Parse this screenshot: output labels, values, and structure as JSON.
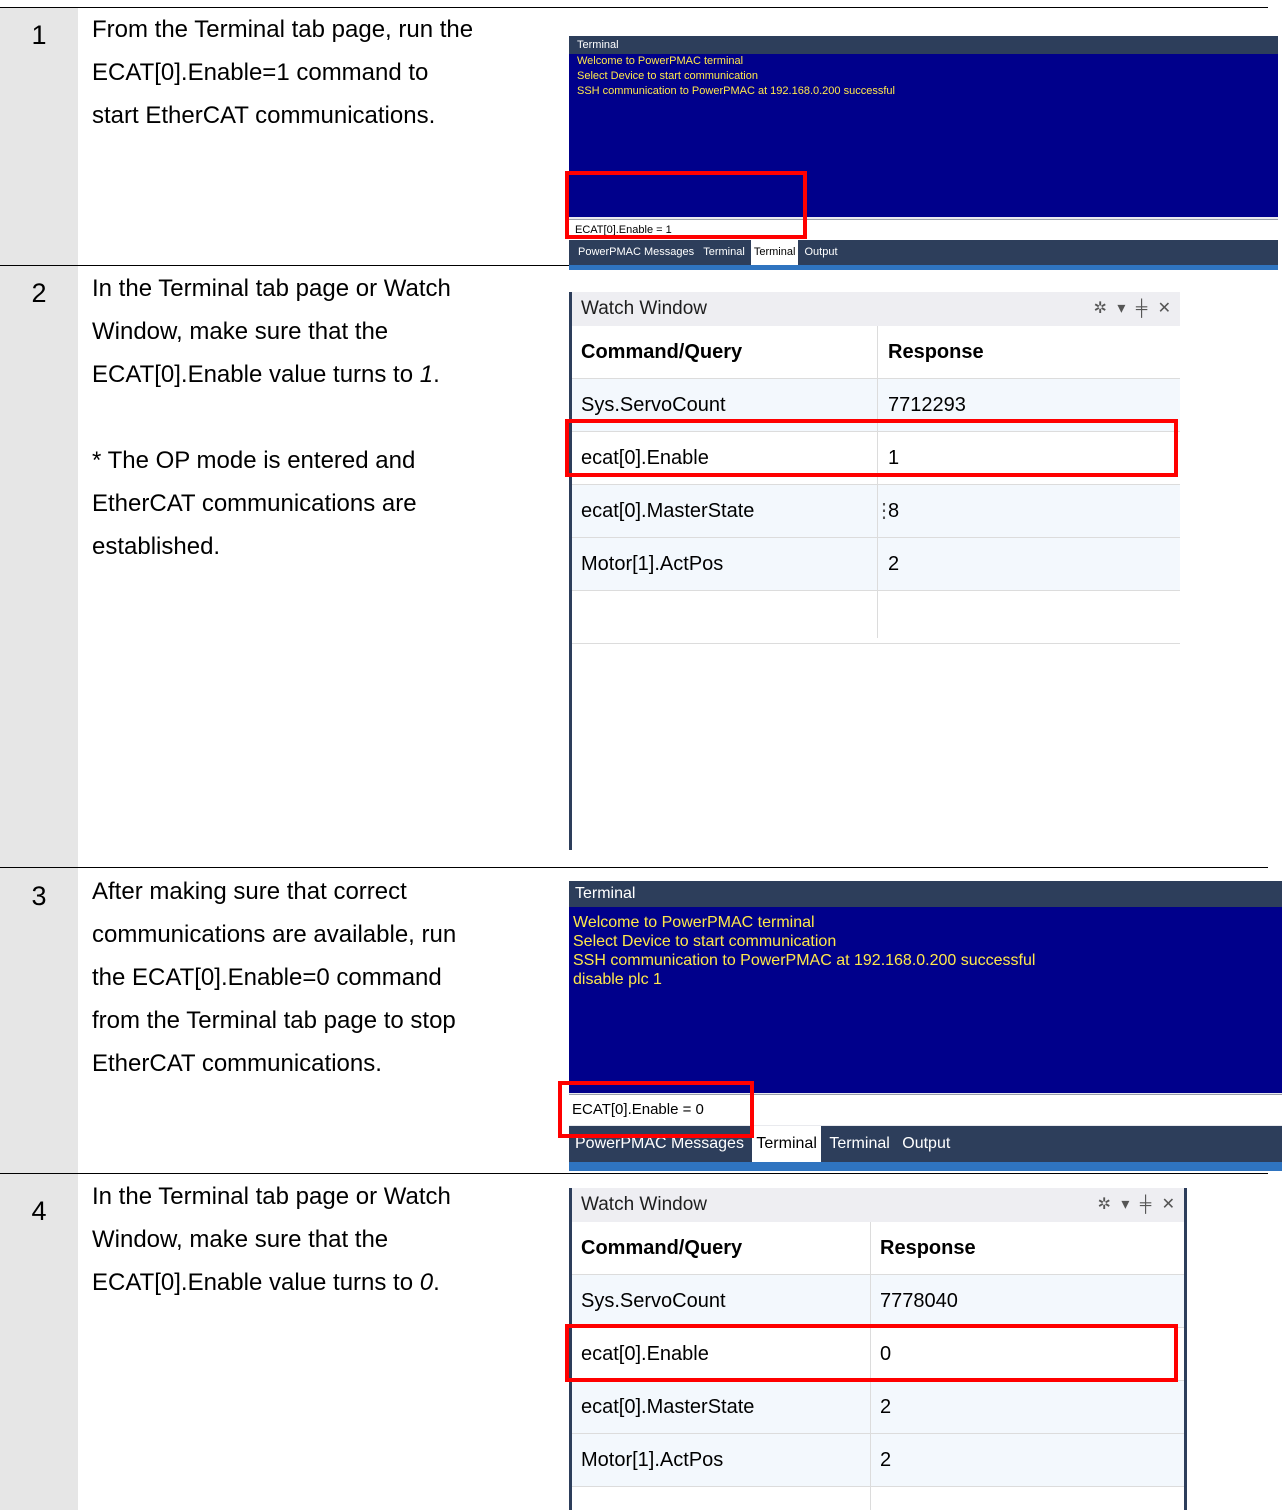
{
  "steps": [
    {
      "num": "1",
      "text": [
        "From the Terminal tab page, run the",
        "ECAT[0].Enable=1 command to",
        "start EtherCAT communications."
      ]
    },
    {
      "num": "2",
      "text": [
        "In the Terminal tab page or Watch",
        "Window, make sure that the"
      ],
      "text_before_em": "ECAT[0].Enable value turns to ",
      "em_value": "1",
      "text_after_em": ".",
      "note": [
        "* The OP mode is entered and",
        "EtherCAT communications are",
        "established."
      ]
    },
    {
      "num": "3",
      "text": [
        "After making sure that correct",
        "communications are available, run",
        "the ECAT[0].Enable=0 command",
        "from the Terminal tab page to stop",
        "EtherCAT communications."
      ]
    },
    {
      "num": "4",
      "text": [
        "In the Terminal tab page or Watch",
        "Window, make sure that the"
      ],
      "text_before_em": "ECAT[0].Enable value turns to ",
      "em_value": "0",
      "text_after_em": "."
    }
  ],
  "terminal1": {
    "title": "Terminal",
    "lines": [
      "Welcome to PowerPMAC terminal",
      "Select Device to start communication",
      "SSH communication to PowerPMAC at 192.168.0.200 successful"
    ],
    "input_value": "ECAT[0].Enable = 1",
    "tabs": [
      "PowerPMAC Messages",
      "Terminal",
      "Terminal",
      "Output"
    ],
    "active_tab_index": 2
  },
  "watch2": {
    "title": "Watch Window",
    "controls": "✲ ▾ ╪ ✕",
    "headers": [
      "Command/Query",
      "Response"
    ],
    "rows": [
      [
        "Sys.ServoCount",
        "7712293"
      ],
      [
        "ecat[0].Enable",
        "1"
      ],
      [
        "ecat[0].MasterState",
        "8"
      ],
      [
        "Motor[1].ActPos",
        "2"
      ],
      [
        "",
        ""
      ]
    ]
  },
  "terminal3": {
    "title": "Terminal",
    "lines": [
      "Welcome to PowerPMAC terminal",
      "Select Device to start communication",
      "SSH communication to PowerPMAC at 192.168.0.200 successful",
      "disable plc 1"
    ],
    "input_value": "ECAT[0].Enable = 0",
    "tabs": [
      "PowerPMAC Messages",
      "Terminal",
      "Terminal",
      "Output"
    ],
    "active_tab_index": 1
  },
  "watch4": {
    "title": "Watch Window",
    "controls": "✲ ▾ ╪ ✕",
    "headers": [
      "Command/Query",
      "Response"
    ],
    "rows": [
      [
        "Sys.ServoCount",
        "7778040"
      ],
      [
        "ecat[0].Enable",
        "0"
      ],
      [
        "ecat[0].MasterState",
        "2"
      ],
      [
        "Motor[1].ActPos",
        "2"
      ],
      [
        "",
        ""
      ]
    ]
  },
  "colors": {
    "step_column": "#e6e6e6",
    "terminal_body": "#00008b",
    "terminal_text": "#ffe84a",
    "title_bar": "#2d3e5b",
    "highlight": "#ff0000"
  }
}
